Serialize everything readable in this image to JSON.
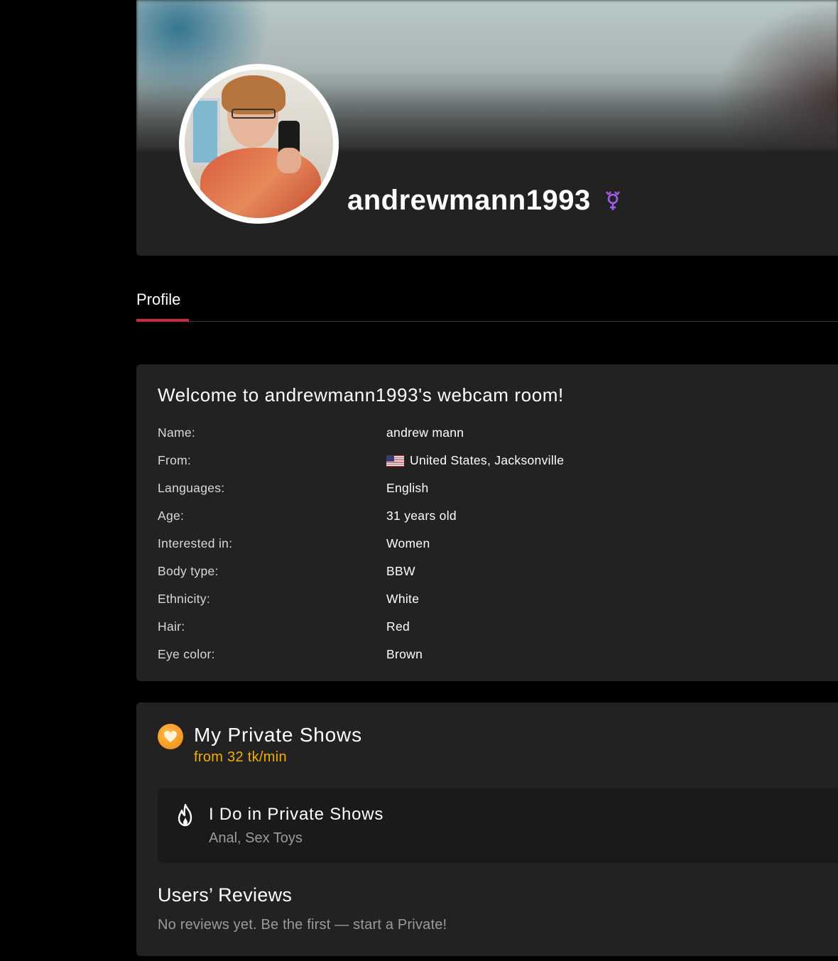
{
  "header": {
    "username": "andrewmann1993",
    "gender_icon": "transgender-icon",
    "gender_color": "#a55bf0"
  },
  "tabs": [
    {
      "label": "Profile",
      "active": true
    }
  ],
  "info": {
    "title": "Welcome to andrewmann1993's webcam room!",
    "rows": [
      {
        "label": "Name:",
        "value": "andrew mann"
      },
      {
        "label": "From:",
        "value": "United States, Jacksonville",
        "flag": "us-flag-icon"
      },
      {
        "label": "Languages:",
        "value": "English"
      },
      {
        "label": "Age:",
        "value": "31 years old"
      },
      {
        "label": "Interested in:",
        "value": "Women"
      },
      {
        "label": "Body type:",
        "value": "BBW"
      },
      {
        "label": "Ethnicity:",
        "value": "White"
      },
      {
        "label": "Hair:",
        "value": "Red"
      },
      {
        "label": "Eye color:",
        "value": "Brown"
      }
    ]
  },
  "private_shows": {
    "title": "My Private Shows",
    "price": "from 32 tk/min",
    "price_color": "#f2b000",
    "icon": "heart-icon",
    "do_title": "I Do in Private Shows",
    "do_list": "Anal, Sex Toys",
    "do_icon": "flame-icon"
  },
  "reviews": {
    "title": "Users’ Reviews",
    "empty_text": "No reviews yet. Be the first — start a Private!"
  },
  "accent_color": "#c8283e"
}
